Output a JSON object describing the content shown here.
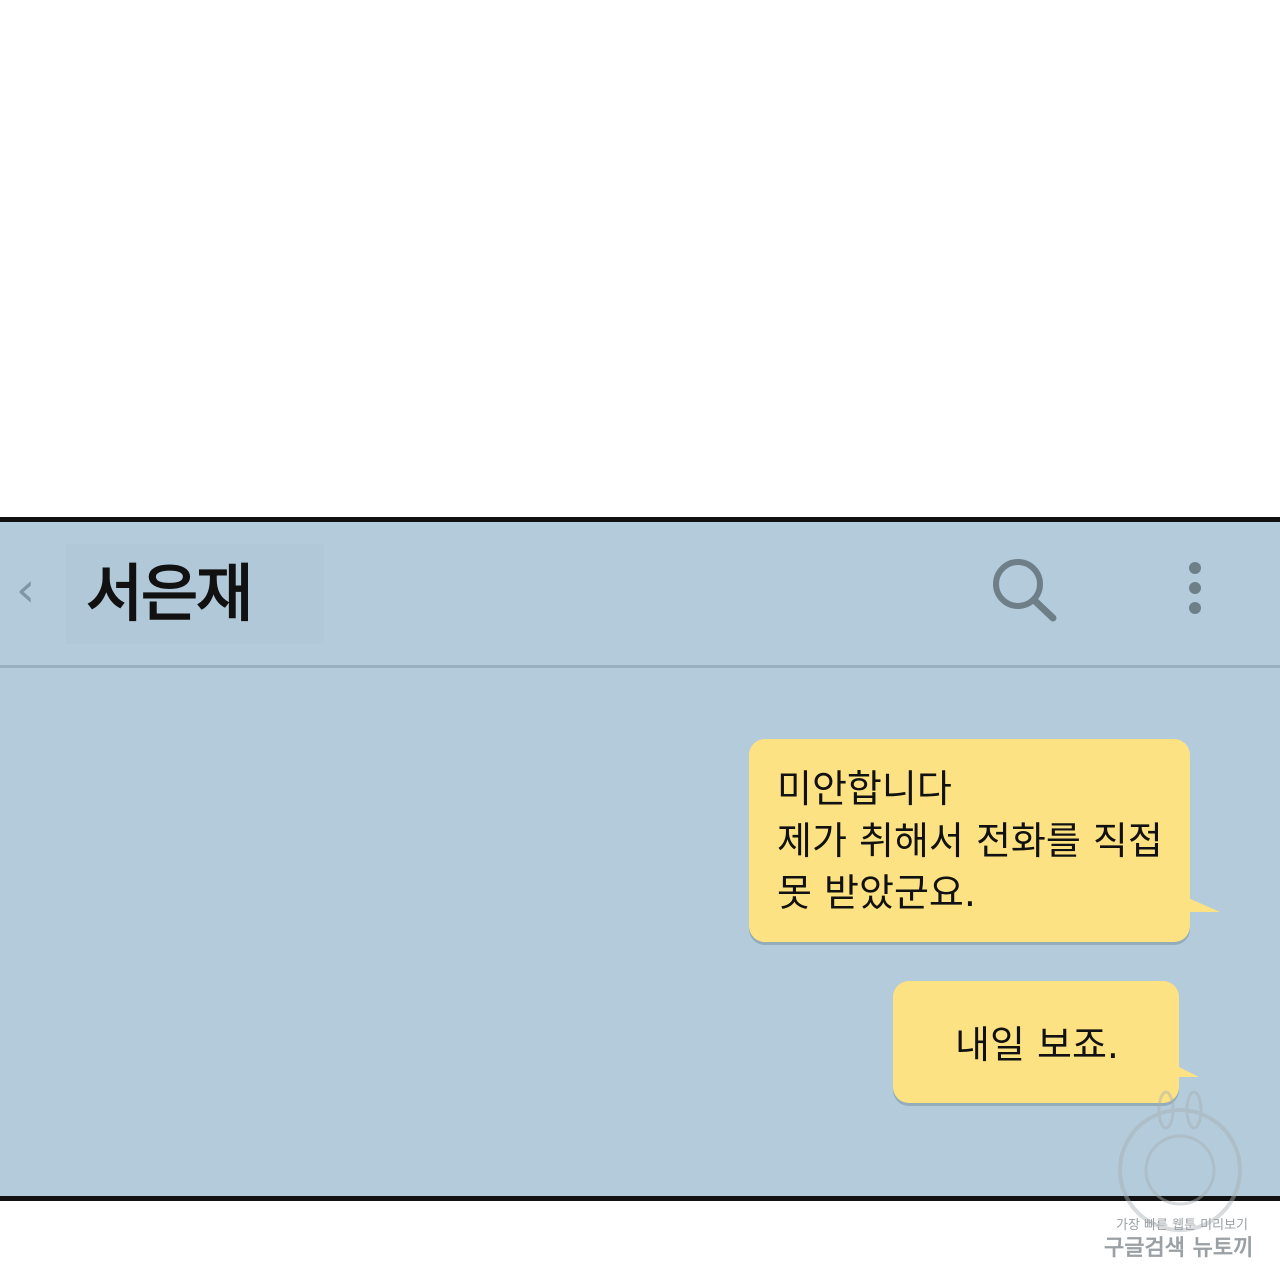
{
  "header": {
    "back_icon": "chevron-left-icon",
    "title": "서은재",
    "search_icon": "search-icon",
    "more_icon": "more-vertical-icon"
  },
  "messages": [
    {
      "lines": [
        "미안합니다",
        "제가 취해서 전화를 직접",
        "못 받았군요."
      ]
    },
    {
      "lines": [
        "내일 보죠."
      ]
    }
  ],
  "watermark": {
    "line1": "가장 빠른 웹툰 미리보기",
    "line2": "구글검색 뉴토끼"
  },
  "colors": {
    "chat_background": "#b3cbda",
    "bubble": "#fde283",
    "border": "#111111"
  }
}
